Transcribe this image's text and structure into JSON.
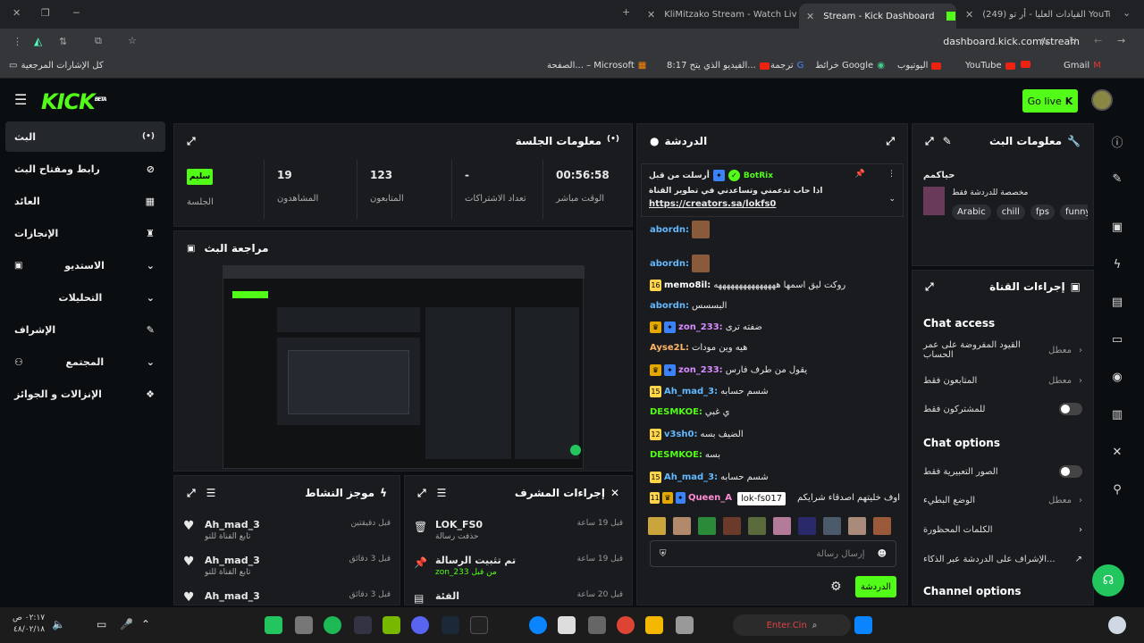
{
  "browser": {
    "tabs": [
      {
        "label": "KliMitzako Stream - Watch Live"
      },
      {
        "label": "Stream - Kick Dashboard"
      },
      {
        "label": "(249) القيادات العليا - أر تو YouTube"
      }
    ],
    "url": "dashboard.kick.com/stream",
    "bookmarks": [
      "Gmail",
      "YouTube",
      "اليوتيوب",
      "خرائط Google",
      "ترجمة",
      "8:17 الفيديو الذي يتح...",
      "الصفحة... – Microsoft",
      "كل الإشارات المرجعية"
    ]
  },
  "header": {
    "logo": "KICK",
    "logo_sup": "BETA",
    "go_live": "Go live"
  },
  "sidebar": {
    "items": [
      {
        "label": "البث",
        "icon": "(•)"
      },
      {
        "label": "رابط ومفتاح البث",
        "icon": "🔗"
      },
      {
        "label": "العائد",
        "icon": "▦"
      },
      {
        "label": "الإنجازات",
        "icon": "🏆"
      },
      {
        "label": "الاستديو",
        "icon": "▣"
      },
      {
        "label": "التحليلات",
        "icon": ""
      },
      {
        "label": "الإشراف",
        "icon": "🔧"
      },
      {
        "label": "المجتمع",
        "icon": "👥"
      },
      {
        "label": "الإنزالات و الجوائز",
        "icon": "🎁"
      }
    ]
  },
  "session": {
    "title": "معلومات الجلسة",
    "stats": [
      {
        "value": "00:56:58",
        "label": "الوقت مباشر"
      },
      {
        "value": "-",
        "label": "تعداد الاشتراكات"
      },
      {
        "value": "123",
        "label": "المتابعون"
      },
      {
        "value": "19",
        "label": "المشاهدون"
      },
      {
        "value": "سليم",
        "label": "الجلسة"
      }
    ]
  },
  "preview": {
    "title": "مراجعة البث"
  },
  "activity": {
    "title": "موجز النشاط",
    "items": [
      {
        "user": "Ah_mad_3",
        "desc": "تابع القناة للتو",
        "time": "قبل دقيقتين"
      },
      {
        "user": "Ah_mad_3",
        "desc": "تابع القناة للتو",
        "time": "قبل 3 دقائق"
      },
      {
        "user": "Ah_mad_3",
        "desc": "",
        "time": "قبل 3 دقائق"
      }
    ]
  },
  "mod": {
    "title": "إجراءات المشرف",
    "items": [
      {
        "user": "LOK_FS0",
        "desc": "حذفت رسالة",
        "time": "قبل 19 ساعة"
      },
      {
        "user": "تم تثبيت الرسالة",
        "desc": "zon_233 من قبل",
        "time": "قبل 19 ساعة"
      },
      {
        "user": "الفئة",
        "desc": "",
        "time": "قبل 20 ساعة"
      }
    ]
  },
  "chat": {
    "title": "الدردشة",
    "pinned": {
      "by": "أرسلت من قبل",
      "user": "BotRix",
      "text": "اذا حاب تدعمني وتساعدني في تطوير القناة",
      "link": "https://creators.sa/lokfs0"
    },
    "messages": [
      {
        "badge": "",
        "user": "abordn:",
        "color": "#62b9ff",
        "text": ""
      },
      {
        "badge": "",
        "user": "abordn:",
        "color": "#62b9ff",
        "text": ""
      },
      {
        "badge": "16",
        "user": "memo8il:",
        "color": "#ffffff",
        "text": "روكت ليق اسمها هههههههههههههههه"
      },
      {
        "badge": "",
        "user": "abordn:",
        "color": "#62b9ff",
        "text": "البسسس"
      },
      {
        "badge": "",
        "user": "zon_233:",
        "color": "#d98cff",
        "text": "ضفته ترى"
      },
      {
        "badge": "",
        "user": "Ayse2L:",
        "color": "#ffb566",
        "text": "هيه وين مودات"
      },
      {
        "badge": "",
        "user": "zon_233:",
        "color": "#d98cff",
        "text": "يقول من طرف فارس"
      },
      {
        "badge": "15",
        "user": "Ah_mad_3:",
        "color": "#62b9ff",
        "text": "شسم حسابه"
      },
      {
        "badge": "",
        "user": "DESMKOE:",
        "color": "#53fc18",
        "text": "ي غبي"
      },
      {
        "badge": "12",
        "user": "v3sh0:",
        "color": "#62b9ff",
        "text": "الضيف بسه"
      },
      {
        "badge": "",
        "user": "DESMKOE:",
        "color": "#53fc18",
        "text": "بسه"
      },
      {
        "badge": "15",
        "user": "Ah_mad_3:",
        "color": "#62b9ff",
        "text": "شسم حسابه"
      },
      {
        "badge": "11",
        "user": "Queen_A",
        "color": "#ff8cd2",
        "text": "اوف خليتهم اصدقاء شرايكم"
      }
    ],
    "tooltip": "lok-fs017",
    "placeholder": "إرسال رسالة",
    "send": "الدردشة"
  },
  "stream_info": {
    "title": "معلومات البث",
    "category": "حياكمم",
    "desc": "مخصصة للدردشة فقط",
    "tags": [
      "Arabic",
      "chill",
      "fps",
      "funny"
    ]
  },
  "channel": {
    "title": "إجراءات القناة",
    "chat_access": "Chat access",
    "access_rows": [
      {
        "label": "القيود المفروضة على عمر الحساب",
        "value": "معطل"
      },
      {
        "label": "المتابعون فقط",
        "value": "معطل"
      },
      {
        "label": "للمشتركون فقط",
        "value": ""
      }
    ],
    "chat_options": "Chat options",
    "option_rows": [
      {
        "label": "الصور التعبيرية فقط",
        "value": ""
      },
      {
        "label": "الوضع البطيء",
        "value": "معطل"
      },
      {
        "label": "الكلمات المحظورة",
        "value": ""
      },
      {
        "label": "الإشراف على الدردشة عبر الذكاء...",
        "value": ""
      }
    ],
    "channel_options": "Channel options"
  },
  "taskbar": {
    "time": "٠٢:١٧ ص",
    "date": "٤٨/٠٢/١٨",
    "search": "Enter.Cin"
  }
}
